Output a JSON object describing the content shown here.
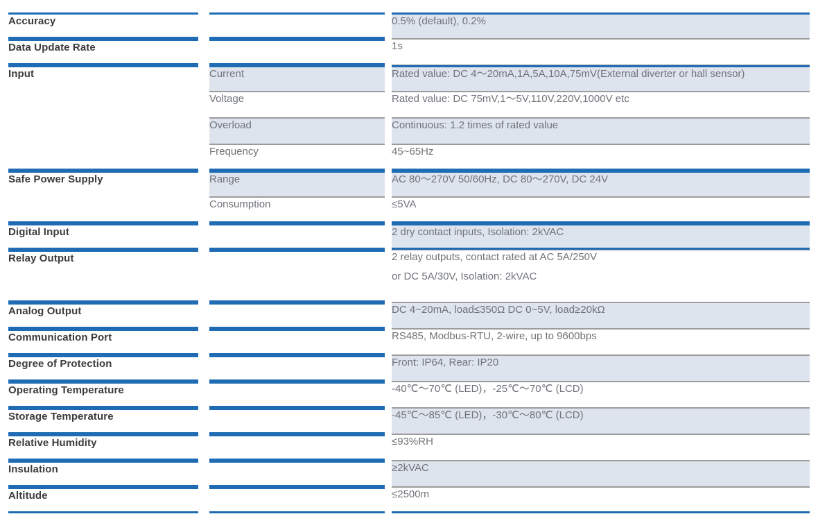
{
  "table": {
    "accent_color": "#1f6cb4",
    "shade_color": "#dee4ee",
    "label_color": "#3c3c3c",
    "value_color": "#6f7378",
    "rows": [
      {
        "label": "Accuracy",
        "sub": "",
        "value": "0.5% (default), 0.2%",
        "shaded": true
      },
      {
        "label": "Data Update Rate",
        "sub": "",
        "value": "1s",
        "shaded": false
      },
      {
        "label": "Input",
        "sub": "Current",
        "value": "Rated value: DC 4～20mA,1A,5A,10A,75mV(External diverter or hall sensor)",
        "shaded": true
      },
      {
        "label": "",
        "sub": "Voltage",
        "value": "Rated value: DC 75mV,1～5V,110V,220V,1000V etc",
        "shaded": false
      },
      {
        "label": "",
        "sub": "Overload",
        "value": "Continuous: 1.2 times of rated value",
        "shaded": true
      },
      {
        "label": "",
        "sub": "Frequency",
        "value": "45~65Hz",
        "shaded": false
      },
      {
        "label": "Safe Power Supply",
        "sub": "Range",
        "value": "AC 80～270V 50/60Hz, DC 80～270V, DC 24V",
        "shaded": true
      },
      {
        "label": "",
        "sub": "Consumption",
        "value": "≤5VA",
        "shaded": false
      },
      {
        "label": "Digital Input",
        "sub": "",
        "value": "2 dry contact inputs, Isolation: 2kVAC",
        "shaded": true
      },
      {
        "label": "Relay Output",
        "sub": "",
        "value": "2 relay outputs, contact rated at AC 5A/250V",
        "value_line2": "or DC 5A/30V,  Isolation: 2kVAC",
        "shaded": false
      },
      {
        "label": "Analog Output",
        "sub": "",
        "value": "DC 4~20mA, load≤350Ω   DC 0~5V, load≥20kΩ",
        "shaded": true
      },
      {
        "label": "Communication Port",
        "sub": "",
        "value": "RS485, Modbus-RTU, 2-wire, up to 9600bps",
        "shaded": false
      },
      {
        "label": "Degree of Protection",
        "sub": "",
        "value": "Front:  IP64, Rear: IP20",
        "shaded": true
      },
      {
        "label": "Operating Temperature",
        "sub": "",
        "value": "-40℃～70℃ (LED)，-25℃～70℃ (LCD)",
        "shaded": false
      },
      {
        "label": "Storage Temperature",
        "sub": "",
        "value": "-45℃～85℃ (LED)，-30℃～80℃ (LCD)",
        "shaded": true
      },
      {
        "label": "Relative Humidity",
        "sub": "",
        "value": "≤93%RH",
        "shaded": false
      },
      {
        "label": "Insulation",
        "sub": "",
        "value": "≥2kVAC",
        "shaded": true
      },
      {
        "label": "Altitude",
        "sub": "",
        "value": "≤2500m",
        "shaded": false
      }
    ]
  }
}
